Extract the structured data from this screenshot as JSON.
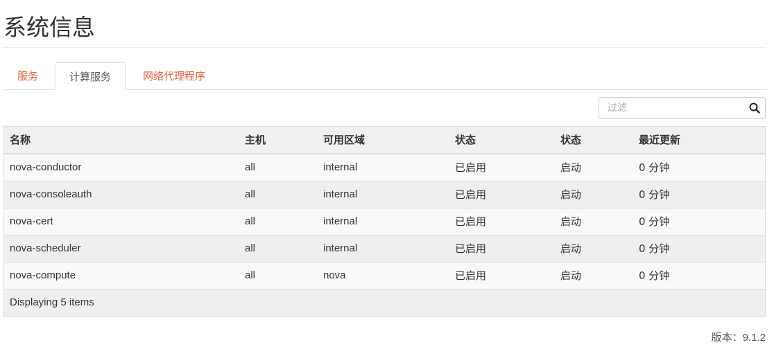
{
  "page_title": "系统信息",
  "tabs": [
    {
      "label": "服务",
      "active": false
    },
    {
      "label": "计算服务",
      "active": true
    },
    {
      "label": "网络代理程序",
      "active": false
    }
  ],
  "filter": {
    "placeholder": "过滤",
    "icon": "search-icon"
  },
  "table": {
    "columns": [
      "名称",
      "主机",
      "可用区域",
      "状态",
      "状态",
      "最近更新"
    ],
    "rows": [
      [
        "nova-conductor",
        "all",
        "internal",
        "已启用",
        "启动",
        "0 分钟"
      ],
      [
        "nova-consoleauth",
        "all",
        "internal",
        "已启用",
        "启动",
        "0 分钟"
      ],
      [
        "nova-cert",
        "all",
        "internal",
        "已启用",
        "启动",
        "0 分钟"
      ],
      [
        "nova-scheduler",
        "all",
        "internal",
        "已启用",
        "启动",
        "0 分钟"
      ],
      [
        "nova-compute",
        "all",
        "nova",
        "已启用",
        "启动",
        "0 分钟"
      ]
    ],
    "footer": "Displaying 5 items"
  },
  "version": {
    "label": "版本：",
    "value": "9.1.2"
  },
  "colors": {
    "link": "#e0633b",
    "header_bg": "#f0f0f0"
  }
}
